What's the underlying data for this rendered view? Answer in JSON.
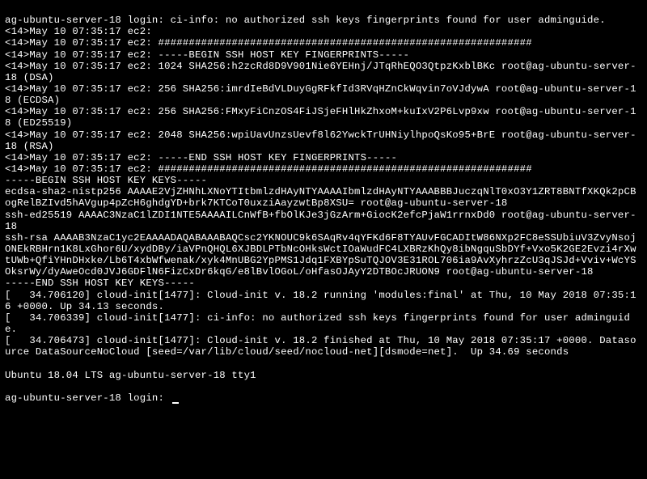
{
  "terminal": {
    "lines": [
      "ag-ubuntu-server-18 login: ci-info: no authorized ssh keys fingerprints found for user adminguide.",
      "<14>May 10 07:35:17 ec2: ",
      "<14>May 10 07:35:17 ec2: #############################################################",
      "<14>May 10 07:35:17 ec2: -----BEGIN SSH HOST KEY FINGERPRINTS-----",
      "<14>May 10 07:35:17 ec2: 1024 SHA256:h2zcRd8D9V901Nie6YEHnj/JTqRhEQO3QtpzKxblBKc root@ag-ubuntu-server-18 (DSA)",
      "<14>May 10 07:35:17 ec2: 256 SHA256:imrdIeBdVLDuyGgRFkfId3RVqHZnCkWqvin7oVJdywA root@ag-ubuntu-server-18 (ECDSA)",
      "<14>May 10 07:35:17 ec2: 256 SHA256:FMxyFiCnzOS4FiJSjeFHlHkZhxoM+kuIxV2P6Lvp9xw root@ag-ubuntu-server-18 (ED25519)",
      "<14>May 10 07:35:17 ec2: 2048 SHA256:wpiUavUnzsUevf8l62YwckTrUHNiylhpoQsKo95+BrE root@ag-ubuntu-server-18 (RSA)",
      "<14>May 10 07:35:17 ec2: -----END SSH HOST KEY FINGERPRINTS-----",
      "<14>May 10 07:35:17 ec2: #############################################################",
      "-----BEGIN SSH HOST KEY KEYS-----",
      "ecdsa-sha2-nistp256 AAAAE2VjZHNhLXNoYTItbmlzdHAyNTYAAAAIbmlzdHAyNTYAAABBBJuczqNlT0xO3Y1ZRT8BNTfXKQk2pCBogRelBZIvd5hAVgup4pZcH6ghdgYD+brk7KTCoT0uxziAayzwtBp8XSU= root@ag-ubuntu-server-18",
      "ssh-ed25519 AAAAC3NzaC1lZDI1NTE5AAAAILCnWfB+fbOlKJe3jGzArm+GiocK2efcPjaW1rrnxDd0 root@ag-ubuntu-server-18",
      "ssh-rsa AAAAB3NzaC1yc2EAAAADAQABAAABAQCsc2YKNOUC9k6SAqRv4qYFKd6F8TYAUvFGCADItW86NXp2FC8eSSUbiuV3ZvyNsojONEkRBHrn1K8LxGhor6U/xydDBy/iaVPnQHQL6XJBDLPTbNcOHksWctIOaWudFC4LXBRzKhQy8ibNgquSbDYf+Vxo5K2GE2Evzi4rXwtUWb+QfiYHnDHxke/Lb6T4xbWfwenak/xyk4MnUBG2YpPMS1Jdq1FXBYpSuTQJOV3E31ROL706ia9AvXyhrzZcU3qJSJd+Vviv+WcYSOksrWy/dyAweOcd0JVJ6GDFlN6FizCxDr6kqG/e8lBvlOGoL/oHfasOJAyY2DTBOcJRUON9 root@ag-ubuntu-server-18",
      "-----END SSH HOST KEY KEYS-----",
      "[   34.706120] cloud-init[1477]: Cloud-init v. 18.2 running 'modules:final' at Thu, 10 May 2018 07:35:16 +0000. Up 34.13 seconds.",
      "[   34.706339] cloud-init[1477]: ci-info: no authorized ssh keys fingerprints found for user adminguide.",
      "[   34.706473] cloud-init[1477]: Cloud-init v. 18.2 finished at Thu, 10 May 2018 07:35:17 +0000. Datasource DataSourceNoCloud [seed=/var/lib/cloud/seed/nocloud-net][dsmode=net].  Up 34.69 seconds",
      "",
      "Ubuntu 18.04 LTS ag-ubuntu-server-18 tty1",
      "",
      "ag-ubuntu-server-18 login: "
    ]
  }
}
